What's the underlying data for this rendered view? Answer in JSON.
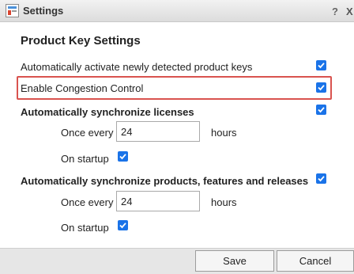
{
  "window": {
    "title": "Settings",
    "help_label": "?",
    "close_label": "X"
  },
  "section_title": "Product Key Settings",
  "settings": {
    "auto_activate": {
      "label": "Automatically activate newly detected product keys",
      "checked": true
    },
    "congestion": {
      "label": "Enable Congestion Control",
      "checked": true
    },
    "sync_licenses": {
      "label": "Automatically synchronize licenses",
      "checked": true,
      "once_every_label": "Once every",
      "interval": "24",
      "unit": "hours",
      "on_startup_label": "On startup",
      "on_startup_checked": true
    },
    "sync_products": {
      "label": "Automatically synchronize products, features and releases",
      "checked": true,
      "once_every_label": "Once every",
      "interval": "24",
      "unit": "hours",
      "on_startup_label": "On startup",
      "on_startup_checked": true
    }
  },
  "footer": {
    "save_label": "Save",
    "cancel_label": "Cancel"
  },
  "colors": {
    "checkbox": "#1a73e8",
    "highlight": "#d9534f"
  }
}
